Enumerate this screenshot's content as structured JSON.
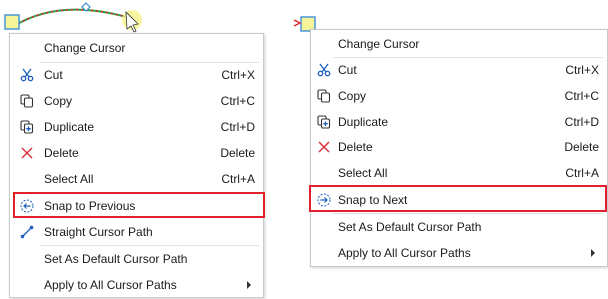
{
  "colors": {
    "highlight": "#e0202a",
    "accent_blue": "#1f5fbf",
    "delete_red": "#d9343c",
    "menu_border": "#c9c9c9"
  },
  "menu_left": {
    "items": [
      {
        "label": "Change Cursor",
        "icon": "",
        "shortcut": ""
      },
      {
        "label": "Cut",
        "icon": "scissors-icon",
        "shortcut": "Ctrl+X"
      },
      {
        "label": "Copy",
        "icon": "copy-icon",
        "shortcut": "Ctrl+C"
      },
      {
        "label": "Duplicate",
        "icon": "duplicate-icon",
        "shortcut": "Ctrl+D"
      },
      {
        "label": "Delete",
        "icon": "delete-x-icon",
        "shortcut": "Delete"
      },
      {
        "label": "Select All",
        "icon": "",
        "shortcut": "Ctrl+A"
      },
      {
        "label": "Snap to Previous",
        "icon": "snap-previous-icon",
        "shortcut": ""
      },
      {
        "label": "Straight Cursor Path",
        "icon": "straight-path-icon",
        "shortcut": ""
      },
      {
        "label": "Set As Default Cursor Path",
        "icon": "",
        "shortcut": ""
      },
      {
        "label": "Apply to All Cursor Paths",
        "icon": "",
        "shortcut": "",
        "submenu": true
      }
    ]
  },
  "menu_right": {
    "items": [
      {
        "label": "Change Cursor",
        "icon": "",
        "shortcut": ""
      },
      {
        "label": "Cut",
        "icon": "scissors-icon",
        "shortcut": "Ctrl+X"
      },
      {
        "label": "Copy",
        "icon": "copy-icon",
        "shortcut": "Ctrl+C"
      },
      {
        "label": "Duplicate",
        "icon": "duplicate-icon",
        "shortcut": "Ctrl+D"
      },
      {
        "label": "Delete",
        "icon": "delete-x-icon",
        "shortcut": "Delete"
      },
      {
        "label": "Select All",
        "icon": "",
        "shortcut": "Ctrl+A"
      },
      {
        "label": "Snap to Next",
        "icon": "snap-next-icon",
        "shortcut": ""
      },
      {
        "label": "Set As Default Cursor Path",
        "icon": "",
        "shortcut": ""
      },
      {
        "label": "Apply to All Cursor Paths",
        "icon": "",
        "shortcut": "",
        "submenu": true
      }
    ]
  }
}
